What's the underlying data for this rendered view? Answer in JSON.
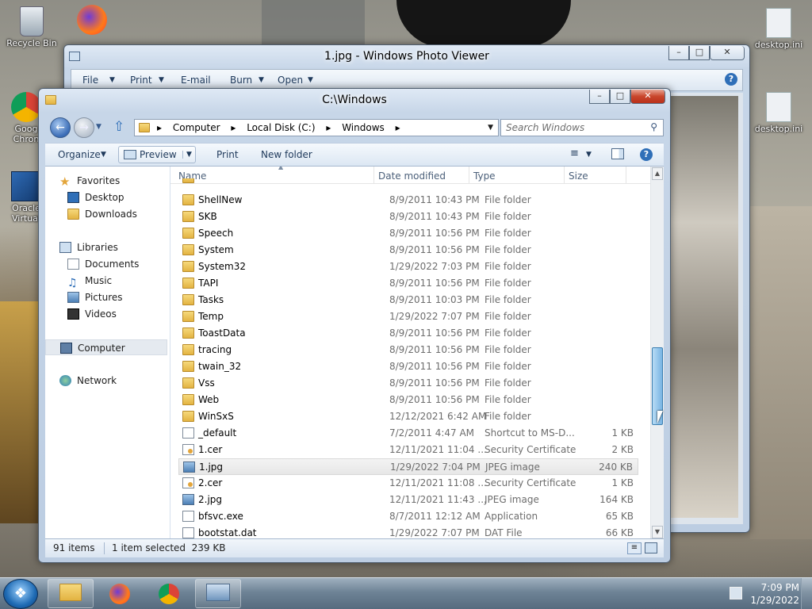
{
  "desktop": {
    "icons": [
      {
        "label": "Recycle Bin"
      },
      {
        "label": "Goog\nChron"
      },
      {
        "label": "Oracle\nVirtual"
      },
      {
        "label": "desktop.ini"
      },
      {
        "label": "desktop.ini"
      }
    ]
  },
  "photo_viewer": {
    "title": "1.jpg - Windows Photo Viewer",
    "menu": [
      "File",
      "Print",
      "E-mail",
      "Burn",
      "Open"
    ]
  },
  "explorer": {
    "title": "C:\\Windows",
    "breadcrumb": [
      "Computer",
      "Local Disk (C:)",
      "Windows"
    ],
    "search_placeholder": "Search Windows",
    "toolbar": {
      "organize": "Organize",
      "preview": "Preview",
      "print": "Print",
      "new_folder": "New folder"
    },
    "nav": {
      "favorites": "Favorites",
      "desktop": "Desktop",
      "downloads": "Downloads",
      "libraries": "Libraries",
      "documents": "Documents",
      "music": "Music",
      "pictures": "Pictures",
      "videos": "Videos",
      "computer": "Computer",
      "network": "Network"
    },
    "columns": {
      "name": "Name",
      "date": "Date modified",
      "type": "Type",
      "size": "Size"
    },
    "files": [
      {
        "name": "ShellNew",
        "date": "8/9/2011 10:43 PM",
        "type": "File folder",
        "size": "",
        "icon": "folder"
      },
      {
        "name": "SKB",
        "date": "8/9/2011 10:43 PM",
        "type": "File folder",
        "size": "",
        "icon": "folder"
      },
      {
        "name": "Speech",
        "date": "8/9/2011 10:56 PM",
        "type": "File folder",
        "size": "",
        "icon": "folder"
      },
      {
        "name": "System",
        "date": "8/9/2011 10:56 PM",
        "type": "File folder",
        "size": "",
        "icon": "folder"
      },
      {
        "name": "System32",
        "date": "1/29/2022 7:03 PM",
        "type": "File folder",
        "size": "",
        "icon": "folder"
      },
      {
        "name": "TAPI",
        "date": "8/9/2011 10:56 PM",
        "type": "File folder",
        "size": "",
        "icon": "folder"
      },
      {
        "name": "Tasks",
        "date": "8/9/2011 10:03 PM",
        "type": "File folder",
        "size": "",
        "icon": "folder"
      },
      {
        "name": "Temp",
        "date": "1/29/2022 7:07 PM",
        "type": "File folder",
        "size": "",
        "icon": "folder"
      },
      {
        "name": "ToastData",
        "date": "8/9/2011 10:56 PM",
        "type": "File folder",
        "size": "",
        "icon": "folder"
      },
      {
        "name": "tracing",
        "date": "8/9/2011 10:56 PM",
        "type": "File folder",
        "size": "",
        "icon": "folder"
      },
      {
        "name": "twain_32",
        "date": "8/9/2011 10:56 PM",
        "type": "File folder",
        "size": "",
        "icon": "folder"
      },
      {
        "name": "Vss",
        "date": "8/9/2011 10:56 PM",
        "type": "File folder",
        "size": "",
        "icon": "folder"
      },
      {
        "name": "Web",
        "date": "8/9/2011 10:56 PM",
        "type": "File folder",
        "size": "",
        "icon": "folder"
      },
      {
        "name": "WinSxS",
        "date": "12/12/2021 6:42 AM",
        "type": "File folder",
        "size": "",
        "icon": "folder"
      },
      {
        "name": "_default",
        "date": "7/2/2011 4:47 AM",
        "type": "Shortcut to MS-D...",
        "size": "1 KB",
        "icon": "file"
      },
      {
        "name": "1.cer",
        "date": "12/11/2021 11:04 ...",
        "type": "Security Certificate",
        "size": "2 KB",
        "icon": "cert"
      },
      {
        "name": "1.jpg",
        "date": "1/29/2022 7:04 PM",
        "type": "JPEG image",
        "size": "240 KB",
        "icon": "image",
        "selected": true
      },
      {
        "name": "2.cer",
        "date": "12/11/2021 11:08 ...",
        "type": "Security Certificate",
        "size": "1 KB",
        "icon": "cert"
      },
      {
        "name": "2.jpg",
        "date": "12/11/2021 11:43 ...",
        "type": "JPEG image",
        "size": "164 KB",
        "icon": "image"
      },
      {
        "name": "bfsvc.exe",
        "date": "8/7/2011 12:12 AM",
        "type": "Application",
        "size": "65 KB",
        "icon": "file"
      },
      {
        "name": "bootstat.dat",
        "date": "1/29/2022 7:07 PM",
        "type": "DAT File",
        "size": "66 KB",
        "icon": "file"
      }
    ],
    "status": {
      "count": "91 items",
      "selection": "1 item selected  239 KB"
    }
  },
  "taskbar": {
    "time": "7:09 PM",
    "date": "1/29/2022"
  }
}
